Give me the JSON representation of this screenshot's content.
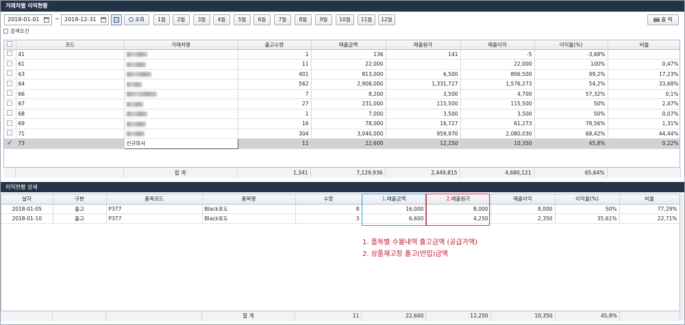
{
  "window_title": "거래처별 이익현황",
  "toolbar": {
    "date_from": "2018-01-01",
    "date_sep": "~",
    "date_to": "2018-12-31",
    "search_label": "조회",
    "month_buttons": [
      "1월",
      "2월",
      "3월",
      "4월",
      "5월",
      "6월",
      "7월",
      "8월",
      "9월",
      "10월",
      "11월",
      "12월"
    ],
    "print_label": "출 력"
  },
  "search_condition_label": "검색조건",
  "grid1": {
    "columns": [
      "코드",
      "거래처명",
      "출고수량",
      "매출금액",
      "매출원가",
      "매출이익",
      "이익율(%)",
      "비율"
    ],
    "rows": [
      {
        "code": "41",
        "name": "",
        "qty": "1",
        "sales": "136",
        "cost": "141",
        "profit": "-5",
        "rate": "-3,68%",
        "ratio": "",
        "selected": false
      },
      {
        "code": "61",
        "name": "",
        "qty": "11",
        "sales": "22,000",
        "cost": "",
        "profit": "22,000",
        "rate": "100%",
        "ratio": "0,47%",
        "selected": false
      },
      {
        "code": "63",
        "name": "",
        "qty": "401",
        "sales": "813,000",
        "cost": "6,500",
        "profit": "806,500",
        "rate": "99,2%",
        "ratio": "17,23%",
        "selected": false
      },
      {
        "code": "64",
        "name": "",
        "qty": "562",
        "sales": "2,908,000",
        "cost": "1,331,727",
        "profit": "1,576,273",
        "rate": "54,2%",
        "ratio": "33,68%",
        "selected": false
      },
      {
        "code": "66",
        "name": "",
        "qty": "7",
        "sales": "8,200",
        "cost": "3,500",
        "profit": "4,700",
        "rate": "57,32%",
        "ratio": "0,1%",
        "selected": false
      },
      {
        "code": "67",
        "name": "",
        "qty": "27",
        "sales": "231,000",
        "cost": "115,500",
        "profit": "115,500",
        "rate": "50%",
        "ratio": "2,47%",
        "selected": false
      },
      {
        "code": "68",
        "name": "",
        "qty": "1",
        "sales": "7,000",
        "cost": "3,500",
        "profit": "3,500",
        "rate": "50%",
        "ratio": "0,07%",
        "selected": false
      },
      {
        "code": "69",
        "name": "",
        "qty": "16",
        "sales": "78,000",
        "cost": "16,727",
        "profit": "61,273",
        "rate": "78,56%",
        "ratio": "1,31%",
        "selected": false
      },
      {
        "code": "71",
        "name": "",
        "qty": "304",
        "sales": "3,040,000",
        "cost": "959,970",
        "profit": "2,080,030",
        "rate": "68,42%",
        "ratio": "44,44%",
        "selected": false
      },
      {
        "code": "73",
        "name": "신규회사",
        "qty": "11",
        "sales": "22,600",
        "cost": "12,250",
        "profit": "10,350",
        "rate": "45,8%",
        "ratio": "0,22%",
        "selected": true
      }
    ],
    "total": {
      "label": "합   계",
      "qty": "1,341",
      "sales": "7,129,936",
      "cost": "2,449,815",
      "profit": "4,680,121",
      "rate": "65,64%",
      "ratio": ""
    }
  },
  "detail_title": "이익현황 상세",
  "grid2": {
    "columns": [
      "날자",
      "구분",
      "품목코드",
      "품목명",
      "수량",
      "1.매출금액",
      "2.매출원가",
      "매출이익",
      "이익율(%)",
      "비율"
    ],
    "col_prefix_blue": "1.",
    "col_prefix_red": "2.",
    "rows": [
      {
        "date": "2018-01-05",
        "type": "출고",
        "item_code": "P377",
        "item_name": "Black포도",
        "qty": "8",
        "sales": "16,000",
        "cost": "8,000",
        "profit": "8,000",
        "rate": "50%",
        "ratio": "77,29%"
      },
      {
        "date": "2018-01-10",
        "type": "출고",
        "item_code": "P377",
        "item_name": "Black포도",
        "qty": "3",
        "sales": "6,600",
        "cost": "4,250",
        "profit": "2,350",
        "rate": "35,61%",
        "ratio": "22,71%"
      }
    ],
    "total": {
      "label": "합   계",
      "qty": "11",
      "sales": "22,600",
      "cost": "12,250",
      "profit": "10,350",
      "rate": "45,8%",
      "ratio": ""
    }
  },
  "notes": [
    "1. 품목별 수불내역 출고금액 (공급가액)",
    "2. 상품재고장 출고(반입)금액"
  ],
  "colors": {
    "title_bar": "#243447",
    "highlight_blue": "#2b9be0",
    "highlight_red": "#e0283c",
    "note_text": "#c0152b"
  }
}
